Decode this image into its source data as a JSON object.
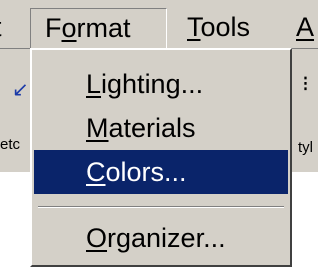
{
  "menubar": {
    "left_clip": "t",
    "format": {
      "prefix": "F",
      "underlined": "o",
      "rest": "rmat"
    },
    "tools": {
      "underlined": "T",
      "rest": "ools"
    },
    "right_clip": "A"
  },
  "toolbar": {
    "etc_text": "etc",
    "tyl_text": "tyl",
    "arrow_icon": "back-arrow-icon",
    "right_icon": "toolbar-icon"
  },
  "dropdown": {
    "items": [
      {
        "underlined": "L",
        "rest": "ighting..."
      },
      {
        "underlined": "M",
        "rest": "aterials"
      },
      {
        "underlined": "C",
        "rest": "olors..."
      },
      {
        "underlined": "O",
        "rest": "rganizer..."
      }
    ],
    "highlight_color": "#0a246a"
  }
}
